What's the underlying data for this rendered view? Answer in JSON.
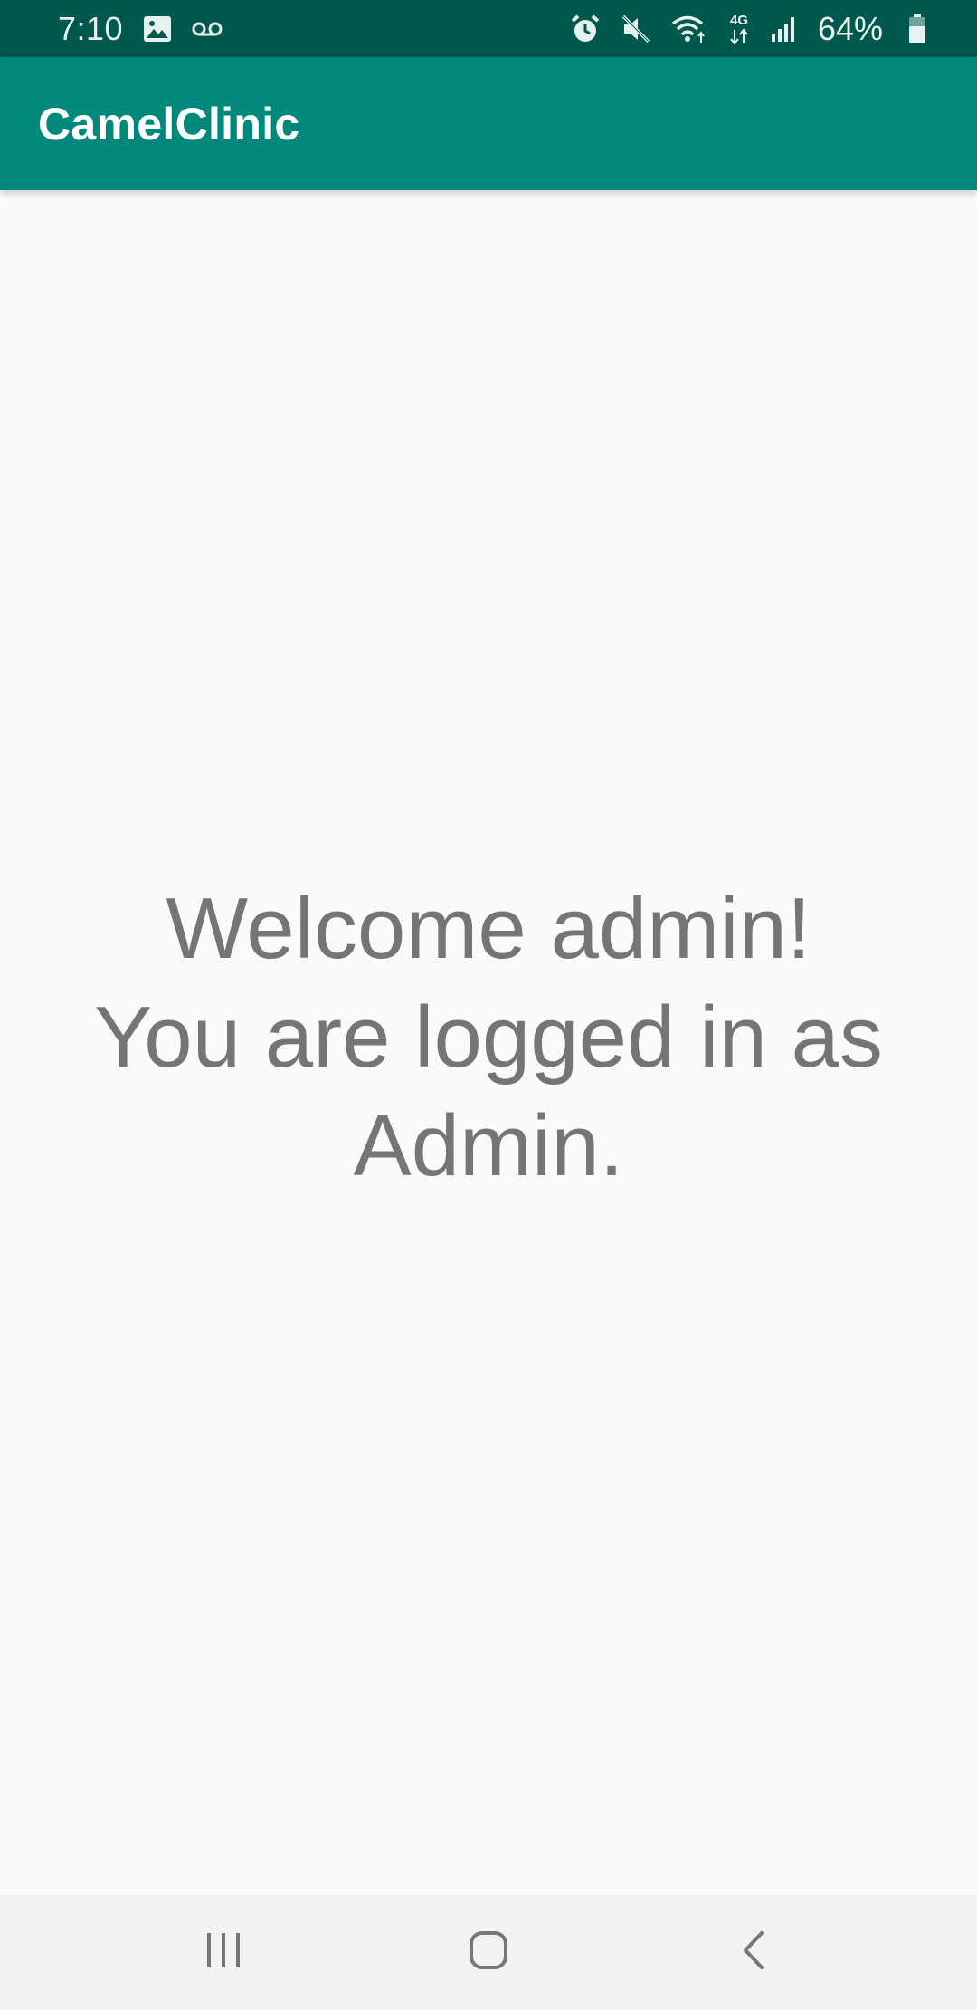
{
  "status_bar": {
    "time": "7:10",
    "left_icons": [
      "image-icon",
      "voicemail-icon"
    ],
    "right_icons": [
      "alarm-icon",
      "mute-icon",
      "wifi-icon",
      "network-4g-icon",
      "signal-icon"
    ],
    "network_label": "4G",
    "battery": "64%",
    "background": "#00574b"
  },
  "app_bar": {
    "title": "CamelClinic",
    "background": "#00897b"
  },
  "main": {
    "welcome_message": "Welcome admin!\nYou are logged in as Admin.",
    "text_color": "#757575"
  },
  "nav_bar": {
    "buttons": [
      "recent-apps-icon",
      "home-icon",
      "back-icon"
    ],
    "background": "#f2f2f2"
  }
}
